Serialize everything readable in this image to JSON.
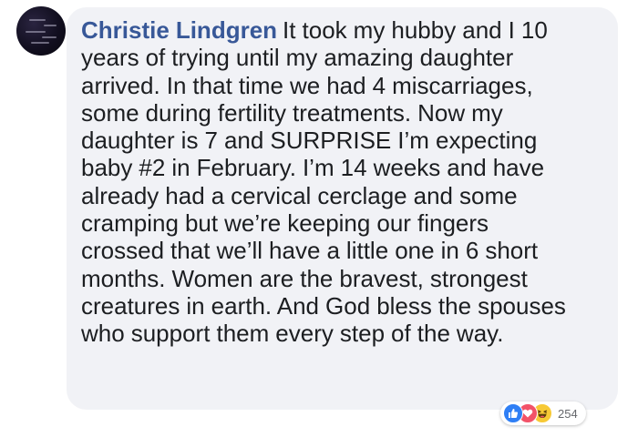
{
  "comment": {
    "author": "Christie Lindgren",
    "text_lines": [
      "It took my hubby and I 10",
      "years of trying until my amazing daughter",
      "arrived. In that time we had 4 miscarriages,",
      "some during fertility treatments. Now my",
      "daughter is 7 and SURPRISE I’m expecting",
      "baby #2 in February. I’m 14 weeks and have",
      "already had a cervical cerclage and some",
      "cramping but we’re keeping our fingers",
      "crossed that we’ll have a little one in 6 short",
      "months. Women are the bravest, strongest",
      "creatures in earth. And God bless the spouses",
      "who support them every step of the way."
    ]
  },
  "reactions": {
    "icons": [
      "like-icon",
      "love-icon",
      "haha-icon"
    ],
    "count": "254"
  },
  "colors": {
    "author_name": "#385898",
    "bubble_background": "#f1f2f6",
    "text": "#1c1e21",
    "like": "#2f7ff5",
    "love": "#f25268",
    "haha": "#f7c935"
  }
}
